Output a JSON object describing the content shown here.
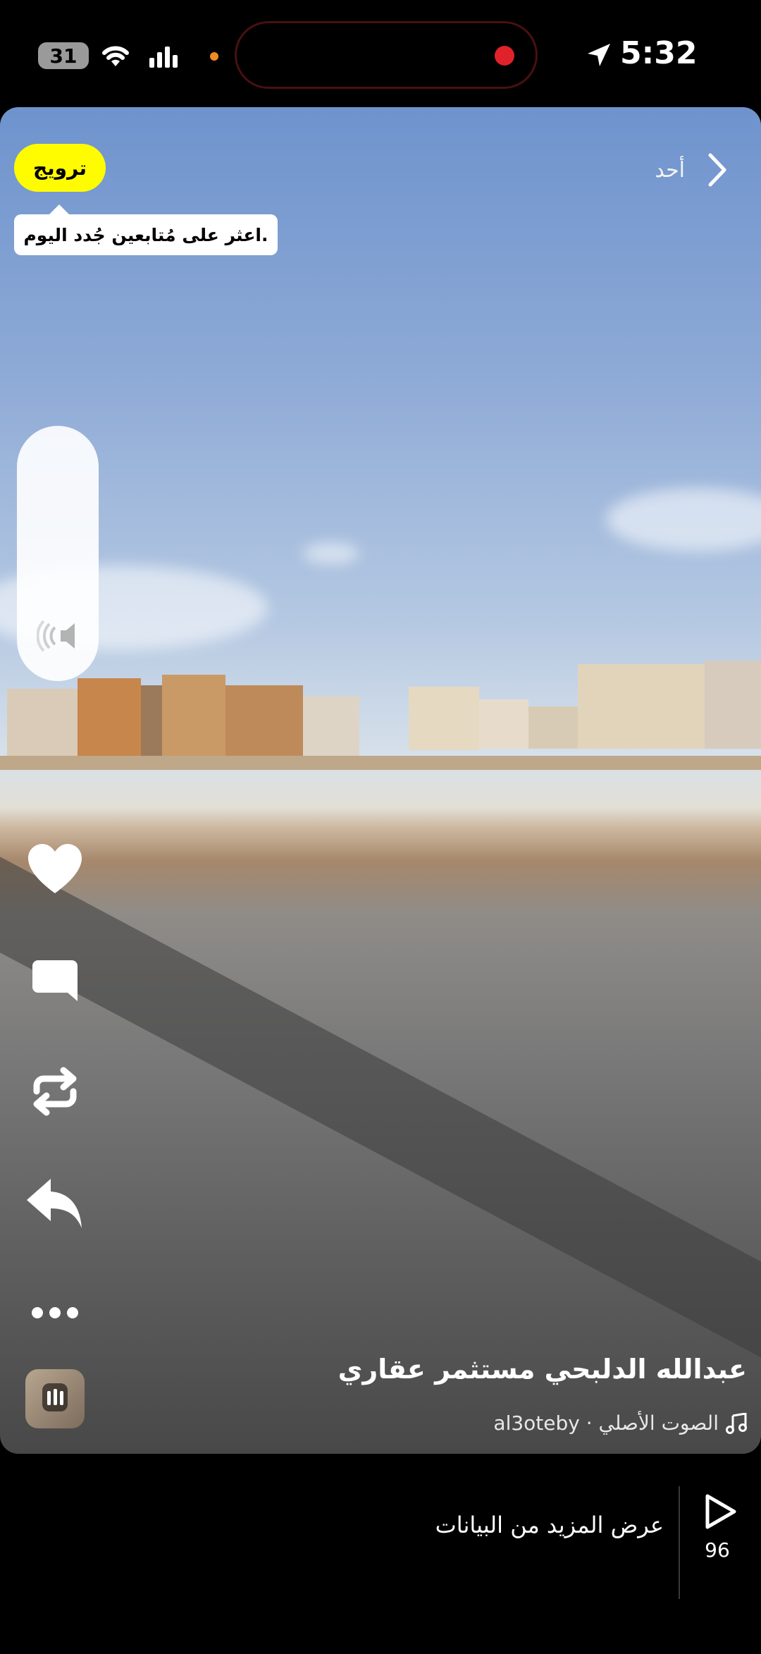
{
  "status_bar": {
    "battery": "31",
    "time": "5:32"
  },
  "top_nav": {
    "label": "أحد"
  },
  "promote": {
    "label": "ترويج",
    "tooltip": "اعثر على مُتابعين جُدد اليوم."
  },
  "video": {
    "caption": "عبدالله الدلبحي مستثمر عقاري",
    "music_text": "الصوت الأصلي · al3oteby"
  },
  "actions": [
    {
      "name": "heart-icon"
    },
    {
      "name": "comment-icon"
    },
    {
      "name": "repost-icon"
    },
    {
      "name": "share-icon"
    },
    {
      "name": "more-icon"
    }
  ],
  "bottom_bar": {
    "more_data_label": "عرض المزيد من البيانات",
    "plays_count": "96"
  },
  "colors": {
    "promote_bg": "#fffc00",
    "record_dot": "#e0222a",
    "accent_orange": "#f08a24"
  }
}
